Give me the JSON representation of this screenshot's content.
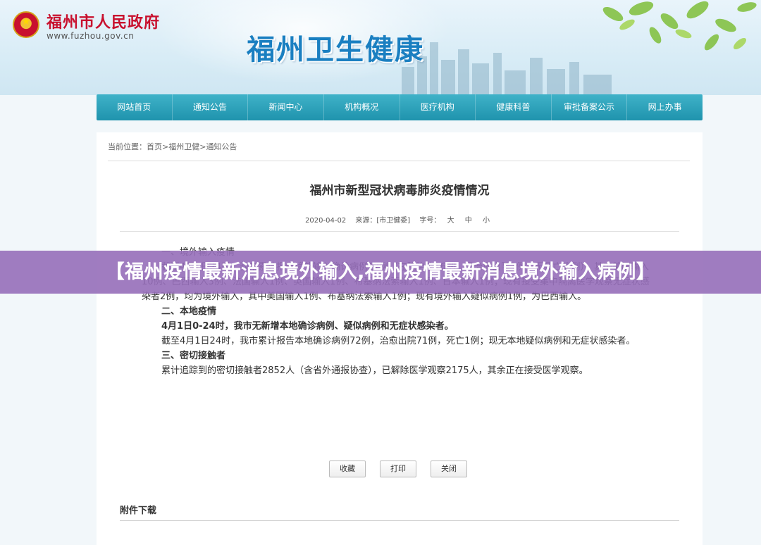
{
  "header": {
    "gov_name": "福州市人民政府",
    "gov_url": "www.fuzhou.gov.cn",
    "site_title": "福州卫生健康"
  },
  "nav": {
    "items": [
      "网站首页",
      "通知公告",
      "新闻中心",
      "机构概况",
      "医疗机构",
      "健康科普",
      "审批备案公示",
      "网上办事"
    ]
  },
  "breadcrumb": {
    "prefix": "当前位置：",
    "home": "首页",
    "sep1": ">",
    "section": "福州卫健",
    "sep2": ">",
    "page": "通知公告"
  },
  "article": {
    "title": "福州市新型冠状病毒肺炎疫情情况",
    "date": "2020-04-02",
    "source": "来源：[市卫健委]",
    "font_label": "字号：",
    "font_sizes": [
      "大",
      "中",
      "小"
    ],
    "sections": {
      "s1_heading": "一、境外输入疫情",
      "s1_p1": "截至4月1日24时，我市累计报告境外输入确诊病例17例（在院治疗16例，已治愈出院1例，无死亡病例），其中美国输入10例、巴西输入3例、法国输入1例、英国输入1例、布基纳法索输入1例、日本输入1例；现有接受集中隔离医学观察无症状感染者2例，均为境外输入，其中美国输入1例、布基纳法索输入1例；现有境外输入疑似病例1例，为巴西输入。",
      "s2_heading": "二、本地疫情",
      "s2_bold": "4月1日0-24时，我市无新增本地确诊病例、疑似病例和无症状感染者。",
      "s2_p1": "截至4月1日24时，我市累计报告本地确诊病例72例，治愈出院71例，死亡1例；现无本地疑似病例和无症状感染者。",
      "s3_heading": "三、密切接触者",
      "s3_p1": "累计追踪到的密切接触者2852人（含省外通报协查），已解除医学观察2175人，其余正在接受医学观察。"
    }
  },
  "buttons": {
    "favorite": "收藏",
    "print": "打印",
    "close": "关闭"
  },
  "attachments": {
    "label": "附件下载"
  },
  "banner": {
    "text": "【福州疫情最新消息境外输入,福州疫情最新消息境外输入病例】"
  },
  "colors": {
    "nav_bg": "#1f93ad",
    "gov_red": "#c8102e",
    "title_blue": "#1a7fc1",
    "banner_bg": "#966eb9"
  }
}
